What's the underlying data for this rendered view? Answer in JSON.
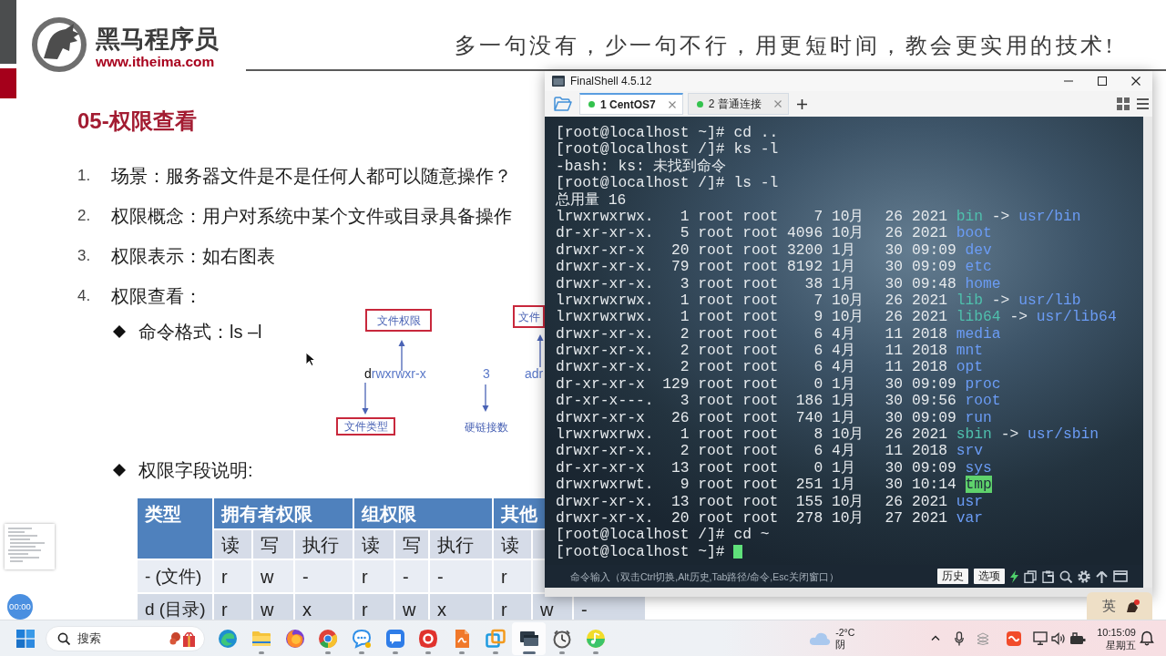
{
  "slide": {
    "brand": {
      "name": "黑马程序员",
      "url": "www.itheima.com"
    },
    "slogan": "多一句没有，少一句不行，用更短时间，教会更实用的技术!",
    "title": "05-权限查看",
    "points": [
      {
        "number": "1.",
        "text": "场景：服务器文件是不是任何人都可以随意操作？"
      },
      {
        "number": "2.",
        "text": "权限概念：用户对系统中某个文件或目录具备操作"
      },
      {
        "number": "3.",
        "text": "权限表示：如右图表"
      },
      {
        "number": "4.",
        "text": "权限查看："
      }
    ],
    "command_format": "命令格式：ls –l",
    "diagram": {
      "file_type": "d",
      "permissions": "rwxrwxr-x",
      "link_count": "3",
      "owner": "adr",
      "labels": [
        {
          "text": "文件权限",
          "boxed": true
        },
        {
          "text": "文件类型",
          "boxed": true
        },
        {
          "text": "硬链接数",
          "boxed": false
        },
        {
          "text": "文件",
          "boxed": true
        }
      ]
    },
    "field_heading": "权限字段说明:",
    "table": {
      "groups": [
        "类型",
        "拥有者权限",
        "组权限",
        "其他"
      ],
      "subheaders": [
        "读",
        "写",
        "执行",
        "读",
        "写",
        "执行",
        "读"
      ],
      "rows": [
        {
          "cells": [
            "- (文件)",
            "r",
            "w",
            "-",
            "r",
            "-",
            "-",
            "r"
          ]
        },
        {
          "cells": [
            "d (目录)",
            "r",
            "w",
            "x",
            "r",
            "w",
            "x",
            "r",
            "w",
            "-"
          ]
        }
      ]
    },
    "timer": "00:00"
  },
  "terminal_window": {
    "title": "FinalShell 4.5.12",
    "tabs": [
      {
        "label": "1 CentOS7",
        "selected": true,
        "connected": true
      },
      {
        "label": "2 普通连接",
        "selected": false,
        "connected": true
      }
    ],
    "lines": [
      {
        "kind": "text",
        "text": "[root@localhost ~]# cd ..",
        "cursor": false
      },
      {
        "kind": "text",
        "text": "[root@localhost /]# ks -l",
        "cursor": false
      },
      {
        "kind": "text",
        "text": "-bash: ks: 未找到命令",
        "cursor": false
      },
      {
        "kind": "text",
        "text": "[root@localhost /]# ls -l",
        "cursor": false
      },
      {
        "kind": "text",
        "text": "总用量 16",
        "cursor": false
      },
      {
        "kind": "link",
        "perms": "lrwxrwxrwx.",
        "links": "1",
        "owner": "root",
        "group": "root",
        "size": "7",
        "month": "10月",
        "day": "26",
        "time": "2021",
        "name": "bin",
        "arrow": "->",
        "target": "usr/bin",
        "cursor": false
      },
      {
        "kind": "dir",
        "perms": "dr-xr-xr-x.",
        "links": "5",
        "owner": "root",
        "group": "root",
        "size": "4096",
        "month": "10月",
        "day": "26",
        "time": "2021",
        "name": "boot",
        "cursor": false
      },
      {
        "kind": "dir",
        "perms": "drwxr-xr-x",
        "links": "20",
        "owner": "root",
        "group": "root",
        "size": "3200",
        "month": "1月",
        "day": "30",
        "time": "09:09",
        "name": "dev",
        "cursor": false
      },
      {
        "kind": "dir",
        "perms": "drwxr-xr-x.",
        "links": "79",
        "owner": "root",
        "group": "root",
        "size": "8192",
        "month": "1月",
        "day": "30",
        "time": "09:09",
        "name": "etc",
        "cursor": false
      },
      {
        "kind": "dir",
        "perms": "drwxr-xr-x.",
        "links": "3",
        "owner": "root",
        "group": "root",
        "size": "38",
        "month": "1月",
        "day": "30",
        "time": "09:48",
        "name": "home",
        "cursor": false
      },
      {
        "kind": "link",
        "perms": "lrwxrwxrwx.",
        "links": "1",
        "owner": "root",
        "group": "root",
        "size": "7",
        "month": "10月",
        "day": "26",
        "time": "2021",
        "name": "lib",
        "arrow": "->",
        "target": "usr/lib",
        "cursor": false
      },
      {
        "kind": "link",
        "perms": "lrwxrwxrwx.",
        "links": "1",
        "owner": "root",
        "group": "root",
        "size": "9",
        "month": "10月",
        "day": "26",
        "time": "2021",
        "name": "lib64",
        "arrow": "->",
        "target": "usr/lib64",
        "cursor": false
      },
      {
        "kind": "dir",
        "perms": "drwxr-xr-x.",
        "links": "2",
        "owner": "root",
        "group": "root",
        "size": "6",
        "month": "4月",
        "day": "11",
        "time": "2018",
        "name": "media",
        "cursor": false
      },
      {
        "kind": "dir",
        "perms": "drwxr-xr-x.",
        "links": "2",
        "owner": "root",
        "group": "root",
        "size": "6",
        "month": "4月",
        "day": "11",
        "time": "2018",
        "name": "mnt",
        "cursor": false
      },
      {
        "kind": "dir",
        "perms": "drwxr-xr-x.",
        "links": "2",
        "owner": "root",
        "group": "root",
        "size": "6",
        "month": "4月",
        "day": "11",
        "time": "2018",
        "name": "opt",
        "cursor": false
      },
      {
        "kind": "dir",
        "perms": "dr-xr-xr-x",
        "links": "129",
        "owner": "root",
        "group": "root",
        "size": "0",
        "month": "1月",
        "day": "30",
        "time": "09:09",
        "name": "proc",
        "cursor": false
      },
      {
        "kind": "dir",
        "perms": "dr-xr-x---.",
        "links": "3",
        "owner": "root",
        "group": "root",
        "size": "186",
        "month": "1月",
        "day": "30",
        "time": "09:56",
        "name": "root",
        "cursor": false
      },
      {
        "kind": "dir",
        "perms": "drwxr-xr-x",
        "links": "26",
        "owner": "root",
        "group": "root",
        "size": "740",
        "month": "1月",
        "day": "30",
        "time": "09:09",
        "name": "run",
        "cursor": false
      },
      {
        "kind": "link",
        "perms": "lrwxrwxrwx.",
        "links": "1",
        "owner": "root",
        "group": "root",
        "size": "8",
        "month": "10月",
        "day": "26",
        "time": "2021",
        "name": "sbin",
        "arrow": "->",
        "target": "usr/sbin",
        "cursor": false
      },
      {
        "kind": "dir",
        "perms": "drwxr-xr-x.",
        "links": "2",
        "owner": "root",
        "group": "root",
        "size": "6",
        "month": "4月",
        "day": "11",
        "time": "2018",
        "name": "srv",
        "cursor": false
      },
      {
        "kind": "dir",
        "perms": "dr-xr-xr-x",
        "links": "13",
        "owner": "root",
        "group": "root",
        "size": "0",
        "month": "1月",
        "day": "30",
        "time": "09:09",
        "name": "sys",
        "cursor": false
      },
      {
        "kind": "sticky",
        "perms": "drwxrwxrwt.",
        "links": "9",
        "owner": "root",
        "group": "root",
        "size": "251",
        "month": "1月",
        "day": "30",
        "time": "10:14",
        "name": "tmp",
        "cursor": false
      },
      {
        "kind": "dir",
        "perms": "drwxr-xr-x.",
        "links": "13",
        "owner": "root",
        "group": "root",
        "size": "155",
        "month": "10月",
        "day": "26",
        "time": "2021",
        "name": "usr",
        "cursor": false
      },
      {
        "kind": "dir",
        "perms": "drwxr-xr-x.",
        "links": "20",
        "owner": "root",
        "group": "root",
        "size": "278",
        "month": "10月",
        "day": "27",
        "time": "2021",
        "name": "var",
        "cursor": false
      },
      {
        "kind": "text",
        "text": "[root@localhost /]# cd ~",
        "cursor": false
      },
      {
        "kind": "text",
        "text": "[root@localhost ~]#",
        "cursor": true
      }
    ],
    "command_bar": {
      "placeholder": "命令输入（双击Ctrl切换,Alt历史,Tab路径/命令,Esc关闭窗口）",
      "buttons": [
        "历史",
        "选项"
      ]
    }
  },
  "ime_bar": {
    "mode": "英"
  },
  "taskbar": {
    "search": {
      "placeholder": "搜索"
    },
    "apps": [
      {
        "running": false,
        "selected": false
      },
      {
        "running": true,
        "selected": false
      },
      {
        "running": false,
        "selected": false
      },
      {
        "running": true,
        "selected": false
      },
      {
        "running": true,
        "selected": false
      },
      {
        "running": true,
        "selected": false
      },
      {
        "running": true,
        "selected": false
      },
      {
        "running": true,
        "selected": false
      },
      {
        "running": true,
        "selected": false
      },
      {
        "running": true,
        "selected": true
      },
      {
        "running": true,
        "selected": false
      },
      {
        "running": true,
        "selected": false
      }
    ],
    "weather": {
      "temperature": "-2°C",
      "condition": "阴"
    },
    "clock": {
      "time": "10:15:09",
      "day": "星期五"
    }
  }
}
